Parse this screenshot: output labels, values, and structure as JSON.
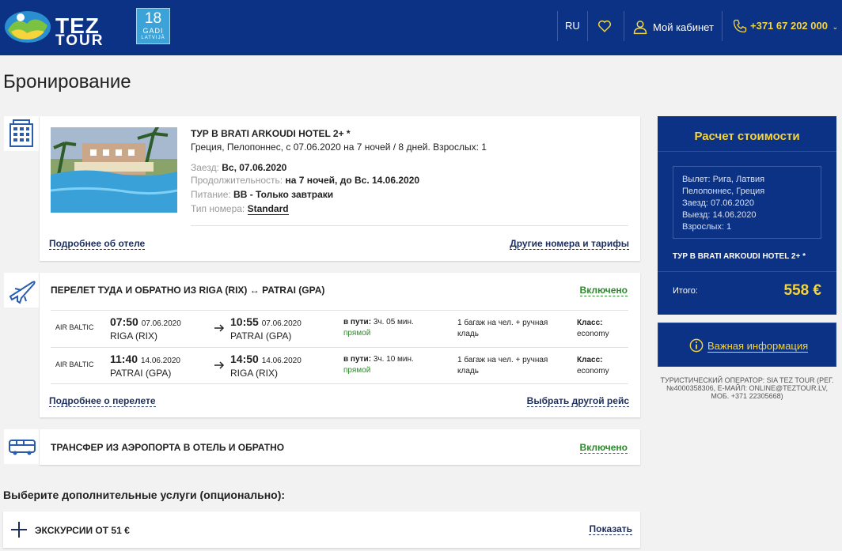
{
  "header": {
    "brand_top": "TEZ",
    "brand_bottom": "TOUR",
    "badge_num": "18",
    "badge_text1": "GADI",
    "badge_text2": "LATVIJĀ",
    "lang": "RU",
    "cabinet": "Мой кабинет",
    "phone": "+371 67 202 000",
    "brand_color": "#0b3284",
    "accent_color": "#f6d43c"
  },
  "page_title": "Бронирование",
  "hotel": {
    "title": "ТУР В BRATI ARKOUDI HOTEL 2+ *",
    "subtitle": "Греция, Пелопоннес, с 07.06.2020 на 7 ночей / 8 дней. Взрослых: 1",
    "checkin_label": "Заезд:",
    "checkin_value": "Вс, 07.06.2020",
    "duration_label": "Продолжительность:",
    "duration_value": "на 7 ночей, до Вс. 14.06.2020",
    "meal_label": "Питание:",
    "meal_value": "BB - Только завтраки",
    "room_label": "Тип номера:",
    "room_value": "Standard",
    "more_link": "Подробнее об отеле",
    "other_link": "Другие номера и тарифы"
  },
  "flight": {
    "title": "ПЕРЕЛЕТ ТУДА И ОБРАТНО ИЗ RIGA (RIX) ↔ PATRAI (GPA)",
    "included": "Включено",
    "rows": [
      {
        "airline": "AIR BALTIC",
        "dep_time": "07:50",
        "dep_date": "07.06.2020",
        "dep_apt": "RIGA (RIX)",
        "arr_time": "10:55",
        "arr_date": "07.06.2020",
        "arr_apt": "PATRAI (GPA)",
        "dur_label": "в пути:",
        "dur": "3ч. 05 мин.",
        "direct": "прямой",
        "baggage": "1 багаж на чел. + ручная кладь",
        "class_label": "Класс:",
        "class": "economy"
      },
      {
        "airline": "AIR BALTIC",
        "dep_time": "11:40",
        "dep_date": "14.06.2020",
        "dep_apt": "PATRAI (GPA)",
        "arr_time": "14:50",
        "arr_date": "14.06.2020",
        "arr_apt": "RIGA (RIX)",
        "dur_label": "в пути:",
        "dur": "3ч. 10 мин.",
        "direct": "прямой",
        "baggage": "1 багаж на чел. + ручная кладь",
        "class_label": "Класс:",
        "class": "economy"
      }
    ],
    "more_link": "Подробнее о перелете",
    "other_link": "Выбрать другой рейс"
  },
  "transfer": {
    "title": "ТРАНСФЕР ИЗ АЭРОПОРТА В ОТЕЛЬ И ОБРАТНО",
    "included": "Включено"
  },
  "optional": {
    "title": "Выберите дополнительные услуги (опционально):",
    "excursions": "ЭКСКУРСИИ ОТ 51 €",
    "show": "Показать"
  },
  "calc": {
    "title": "Расчет стоимости",
    "lines": [
      "Вылет: Рига, Латвия",
      "Пелопоннес, Греция",
      "Заезд: 07.06.2020",
      "Выезд: 14.06.2020",
      "Взрослых: 1"
    ],
    "hotel": "ТУР В BRATI ARKOUDI HOTEL 2+ *",
    "total_label": "Итого:",
    "total_value": "558 €"
  },
  "info": {
    "text": "Важная информация"
  },
  "operator": "ТУРИСТИЧЕСКИЙ ОПЕРАТОР: SIA TEZ TOUR (РЕГ. №4000358306, E-МАЙЛ: ONLINE@TEZTOUR.LV, МОБ. +371 22305668)"
}
